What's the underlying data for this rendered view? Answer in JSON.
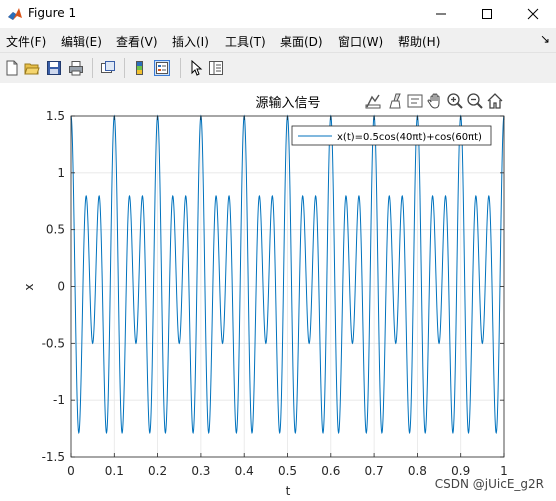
{
  "window": {
    "title": "Figure 1",
    "controls": [
      "minimize",
      "maximize",
      "close"
    ]
  },
  "menu": {
    "items": [
      "文件(F)",
      "编辑(E)",
      "查看(V)",
      "插入(I)",
      "工具(T)",
      "桌面(D)",
      "窗口(W)",
      "帮助(H)"
    ],
    "overflow_glyph": "↘"
  },
  "toolbar": {
    "icons": [
      "new-figure-icon",
      "open-file-icon",
      "save-icon",
      "print-icon",
      "link-plot-icon",
      "insert-colorbar-icon",
      "insert-legend-icon",
      "edit-plot-icon",
      "property-inspector-icon"
    ]
  },
  "axes_toolbar": {
    "icons": [
      "export-icon",
      "brush-icon",
      "data-tips-icon",
      "pan-icon",
      "zoom-in-icon",
      "zoom-out-icon",
      "home-icon"
    ]
  },
  "chart_data": {
    "type": "line",
    "title": "源输入信号",
    "xlabel": "t",
    "ylabel": "x",
    "xlim": [
      0,
      1
    ],
    "ylim": [
      -1.5,
      1.5
    ],
    "x_ticks": [
      "0",
      "0.1",
      "0.2",
      "0.3",
      "0.4",
      "0.5",
      "0.6",
      "0.7",
      "0.8",
      "0.9",
      "1"
    ],
    "y_ticks": [
      "1.5",
      "1",
      "0.5",
      "0",
      "-0.5",
      "-1",
      "-1.5"
    ],
    "grid": true,
    "legend_position": "top-right",
    "series": [
      {
        "name": "x(t)=0.5cos(40πt)+cos(60πt)",
        "expression": "0.5cos(40πt)+cos(60πt)",
        "color": "#0072BD",
        "x_range": [
          0,
          1
        ]
      }
    ]
  },
  "watermark": "CSDN @jUicE_g2R"
}
